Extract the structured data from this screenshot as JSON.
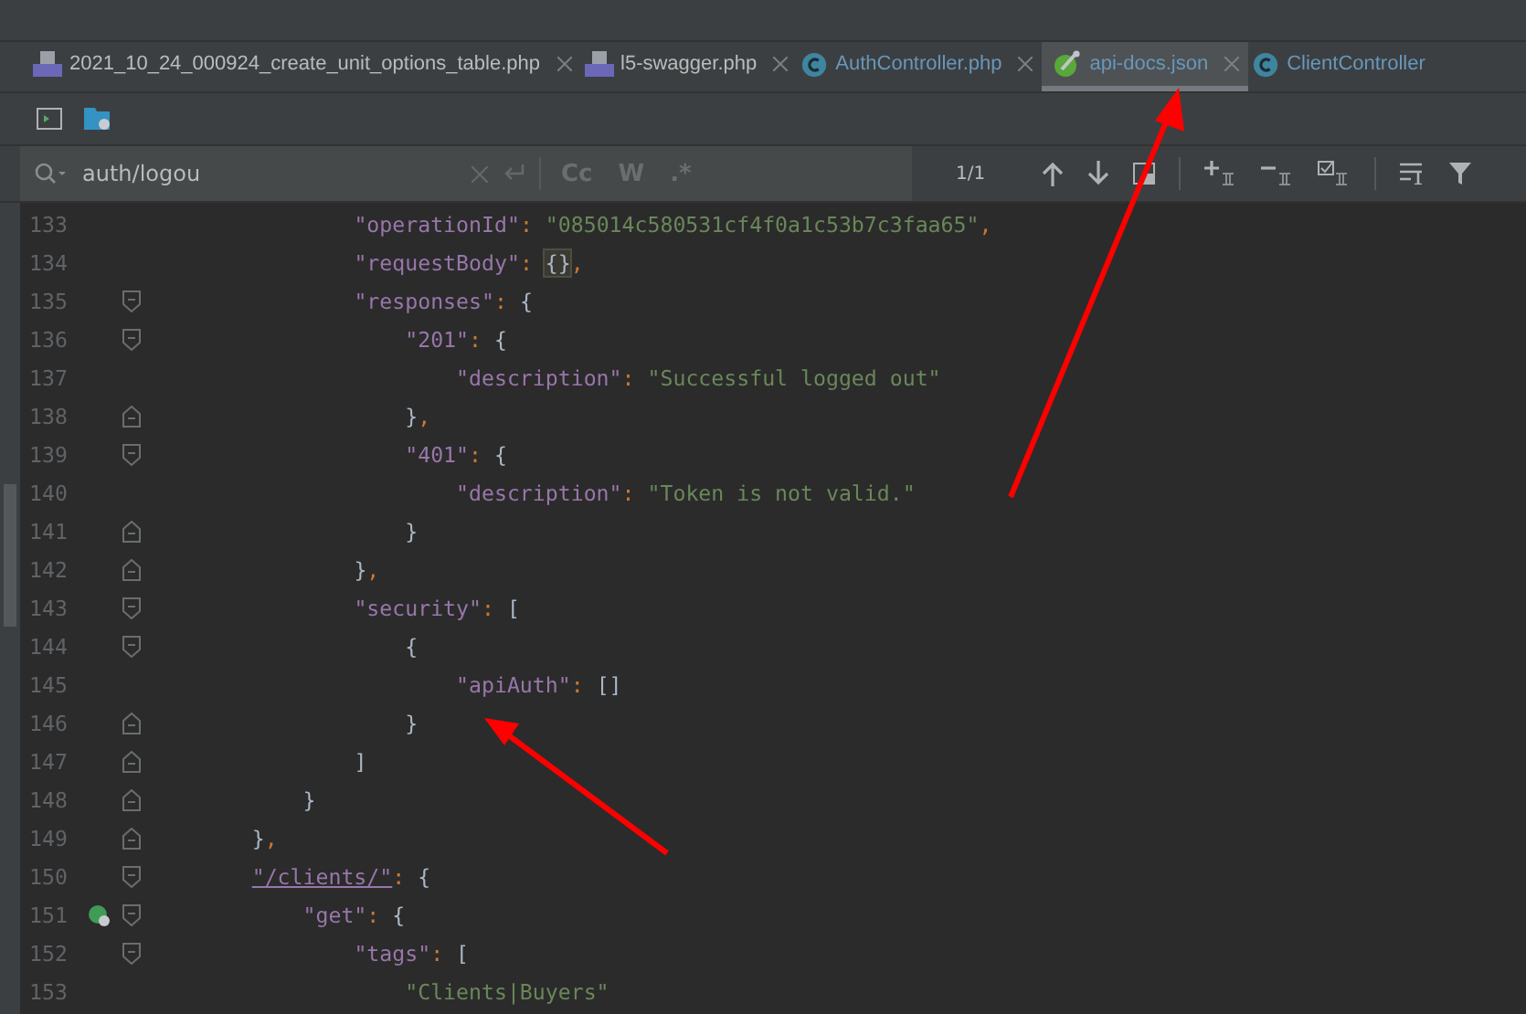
{
  "tabs": [
    {
      "label": "2021_10_24_000924_create_unit_options_table.php",
      "kind": "php",
      "closable": true,
      "selected": false
    },
    {
      "label": "l5-swagger.php",
      "kind": "php",
      "closable": true,
      "selected": false
    },
    {
      "label": "AuthController.php",
      "kind": "class",
      "closable": true,
      "selected": false
    },
    {
      "label": "api-docs.json",
      "kind": "json",
      "closable": true,
      "selected": true
    },
    {
      "label": "ClientController",
      "kind": "class",
      "closable": false,
      "selected": false
    }
  ],
  "search": {
    "value": "auth/logou",
    "options": [
      {
        "label": "Cc",
        "on": false
      },
      {
        "label": "W",
        "on": false
      },
      {
        "label": ".*",
        "on": false
      }
    ],
    "count": "1/1"
  },
  "lines": [
    {
      "number": "133",
      "kind": "plain",
      "tokens": [
        {
          "kind": "key",
          "text": "                \"operationId\""
        },
        {
          "kind": "punct",
          "text": ": "
        },
        {
          "kind": "string",
          "text": "\"085014c580531cf4f0a1c53b7c3faa65\""
        },
        {
          "kind": "punct",
          "text": ","
        }
      ]
    },
    {
      "number": "134",
      "kind": "plain",
      "tokens": [
        {
          "kind": "key",
          "text": "                \"requestBody\""
        },
        {
          "kind": "punct",
          "text": ": "
        },
        {
          "kind": "match",
          "text": "{}"
        },
        {
          "kind": "punct",
          "text": ","
        }
      ]
    },
    {
      "number": "135",
      "kind": "fold-start",
      "tokens": [
        {
          "kind": "key",
          "text": "                \"responses\""
        },
        {
          "kind": "punct",
          "text": ": "
        },
        {
          "kind": "brace",
          "text": "{"
        }
      ]
    },
    {
      "number": "136",
      "kind": "fold-start",
      "tokens": [
        {
          "kind": "key",
          "text": "                    \"201\""
        },
        {
          "kind": "punct",
          "text": ": "
        },
        {
          "kind": "brace",
          "text": "{"
        }
      ]
    },
    {
      "number": "137",
      "kind": "plain",
      "tokens": [
        {
          "kind": "key",
          "text": "                        \"description\""
        },
        {
          "kind": "punct",
          "text": ": "
        },
        {
          "kind": "string",
          "text": "\"Successful logged out\""
        }
      ]
    },
    {
      "number": "138",
      "kind": "fold-end",
      "tokens": [
        {
          "kind": "brace",
          "text": "                    }"
        },
        {
          "kind": "punct",
          "text": ","
        }
      ]
    },
    {
      "number": "139",
      "kind": "fold-start",
      "tokens": [
        {
          "kind": "key",
          "text": "                    \"401\""
        },
        {
          "kind": "punct",
          "text": ": "
        },
        {
          "kind": "brace",
          "text": "{"
        }
      ]
    },
    {
      "number": "140",
      "kind": "plain",
      "tokens": [
        {
          "kind": "key",
          "text": "                        \"description\""
        },
        {
          "kind": "punct",
          "text": ": "
        },
        {
          "kind": "string",
          "text": "\"Token is not valid.\""
        }
      ]
    },
    {
      "number": "141",
      "kind": "fold-end",
      "tokens": [
        {
          "kind": "brace",
          "text": "                    }"
        }
      ]
    },
    {
      "number": "142",
      "kind": "fold-end",
      "tokens": [
        {
          "kind": "brace",
          "text": "                }"
        },
        {
          "kind": "punct",
          "text": ","
        }
      ]
    },
    {
      "number": "143",
      "kind": "fold-start",
      "tokens": [
        {
          "kind": "key",
          "text": "                \"security\""
        },
        {
          "kind": "punct",
          "text": ": "
        },
        {
          "kind": "brace",
          "text": "["
        }
      ]
    },
    {
      "number": "144",
      "kind": "fold-start",
      "tokens": [
        {
          "kind": "brace",
          "text": "                    {"
        }
      ]
    },
    {
      "number": "145",
      "kind": "plain",
      "tokens": [
        {
          "kind": "key",
          "text": "                        \"apiAuth\""
        },
        {
          "kind": "punct",
          "text": ": "
        },
        {
          "kind": "brace",
          "text": "[]"
        }
      ]
    },
    {
      "number": "146",
      "kind": "fold-end",
      "tokens": [
        {
          "kind": "brace",
          "text": "                    }"
        }
      ]
    },
    {
      "number": "147",
      "kind": "fold-end",
      "tokens": [
        {
          "kind": "brace",
          "text": "                ]"
        }
      ]
    },
    {
      "number": "148",
      "kind": "fold-end",
      "tokens": [
        {
          "kind": "brace",
          "text": "            }"
        }
      ]
    },
    {
      "number": "149",
      "kind": "fold-end",
      "tokens": [
        {
          "kind": "brace",
          "text": "        }"
        },
        {
          "kind": "punct",
          "text": ","
        }
      ]
    },
    {
      "number": "150",
      "kind": "fold-start",
      "tokens": [
        {
          "kind": "link",
          "text": "        \"/clients/\""
        },
        {
          "kind": "punct",
          "text": ": "
        },
        {
          "kind": "brace",
          "text": "{"
        }
      ]
    },
    {
      "number": "151",
      "kind": "fold-start",
      "run_icon": true,
      "tokens": [
        {
          "kind": "key",
          "text": "            \"get\""
        },
        {
          "kind": "punct",
          "text": ": "
        },
        {
          "kind": "brace",
          "text": "{"
        }
      ]
    },
    {
      "number": "152",
      "kind": "fold-start",
      "tokens": [
        {
          "kind": "key",
          "text": "                \"tags\""
        },
        {
          "kind": "punct",
          "text": ": "
        },
        {
          "kind": "brace",
          "text": "["
        }
      ]
    },
    {
      "number": "153",
      "kind": "plain",
      "tokens": [
        {
          "kind": "string",
          "text": "                    \"Clients|Buyers\""
        }
      ]
    }
  ]
}
